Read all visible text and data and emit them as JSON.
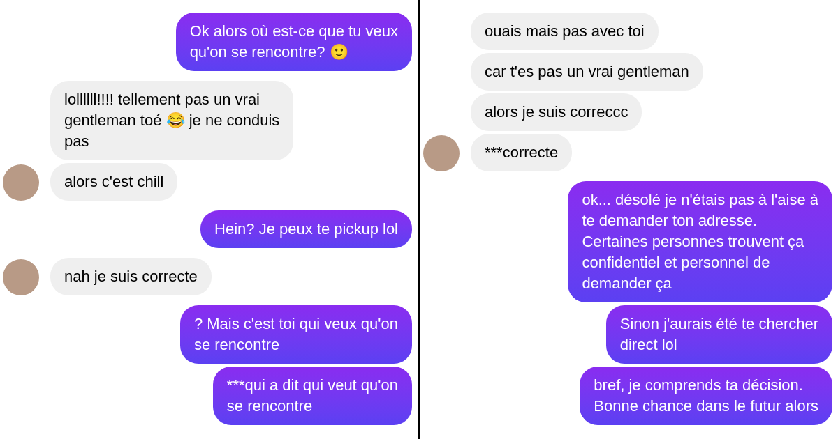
{
  "panels": [
    {
      "messages": [
        {
          "kind": "sent",
          "text": "Ok alors où est-ce que tu veux\nqu'on se rencontre? 🙂"
        },
        {
          "kind": "received",
          "avatar": false,
          "text": "lollllll!!!! tellement pas un vrai\ngentleman toé 😂 je ne conduis\npas"
        },
        {
          "kind": "received",
          "avatar": true,
          "text": "alors c'est chill"
        },
        {
          "kind": "sent",
          "text": "Hein? Je peux te pickup lol"
        },
        {
          "kind": "received",
          "avatar": true,
          "text": "nah je suis correcte"
        },
        {
          "kind": "sent",
          "text": "? Mais c'est toi qui veux qu'on\nse rencontre"
        },
        {
          "kind": "sent",
          "text": "***qui a dit qui veut qu'on\nse rencontre"
        }
      ]
    },
    {
      "messages": [
        {
          "kind": "received",
          "avatar": false,
          "text": "ouais mais pas avec toi"
        },
        {
          "kind": "received",
          "avatar": false,
          "text": "car t'es pas un vrai gentleman"
        },
        {
          "kind": "received",
          "avatar": false,
          "text": "alors je suis correccc"
        },
        {
          "kind": "received",
          "avatar": true,
          "text": "***correcte"
        },
        {
          "kind": "sent",
          "text": "ok... désolé je n'étais pas à l'aise à\nte demander ton adresse.\nCertaines personnes trouvent ça\nconfidentiel et personnel de\ndemander ça"
        },
        {
          "kind": "sent",
          "text": "Sinon j'aurais été te chercher\ndirect lol"
        },
        {
          "kind": "sent",
          "text": "bref, je comprends ta décision.\nBonne chance dans le futur alors"
        }
      ]
    }
  ]
}
